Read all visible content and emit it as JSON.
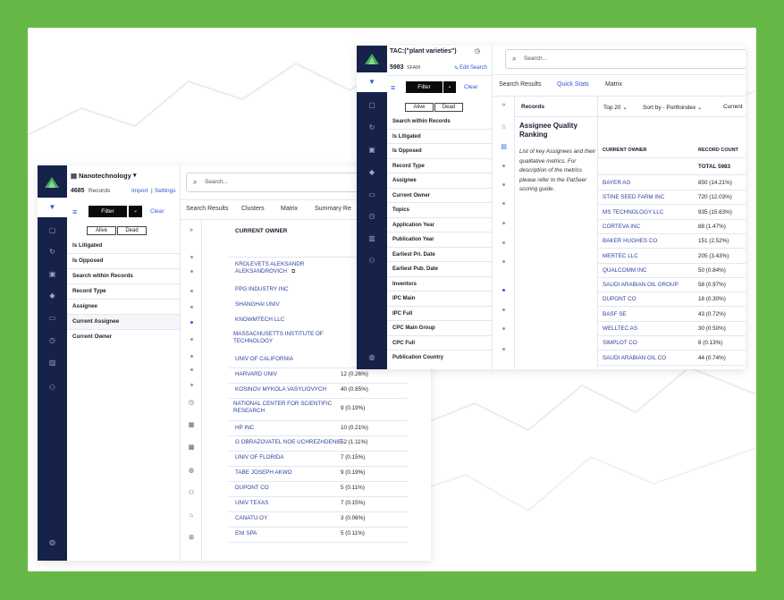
{
  "colors": {
    "frame_green": "#66b846",
    "nav_navy": "#16224a",
    "link_blue": "#2a5bd7"
  },
  "left_panel": {
    "workspace_title": "Nanotechnology",
    "records_count": "4685",
    "records_label": "Records",
    "import_label": "Import",
    "settings_label": "Settings",
    "filter_label": "Filter",
    "clear_label": "Clear",
    "alive_label": "Alive",
    "dead_label": "Dead",
    "menu": [
      "Is Litigated",
      "Is Opposed",
      "Search within Records",
      "Record Type",
      "Assignee",
      "Current Assignee",
      "Current Owner"
    ],
    "search_placeholder": "Search...",
    "tabs": [
      "Search Results",
      "Clusters",
      "Matrix",
      "Summary Re"
    ],
    "column_header": "CURRENT OWNER",
    "rows": [
      {
        "owner": "KROLEVETS ALEKSANDR ALEKSANDROVICH",
        "count": ""
      },
      {
        "owner": "PPG INDUSTRY INC",
        "count": ""
      },
      {
        "owner": "SHANGHAI UNIV",
        "count": ""
      },
      {
        "owner": "KNOWMTECH LLC",
        "count": ""
      },
      {
        "owner": "MASSACHUSETTS INSTITUTE OF TECHNOLOGY",
        "count": ""
      },
      {
        "owner": "UNIV OF CALIFORNIA",
        "count": ""
      },
      {
        "owner": "HARVARD UNIV",
        "count": "12 (0.26%)"
      },
      {
        "owner": "KOSINOV MYKOLA VASYLIOVYCH",
        "count": "40 (0.85%)"
      },
      {
        "owner": "NATIONAL CENTER FOR SCIENTIFIC RESEARCH",
        "count": "9 (0.19%)"
      },
      {
        "owner": "HP INC",
        "count": "10 (0.21%)"
      },
      {
        "owner": "G OBRAZOVATEL NOE UCHREZHDENIE",
        "count": "52 (1.11%)"
      },
      {
        "owner": "UNIV OF FLORIDA",
        "count": "7 (0.15%)"
      },
      {
        "owner": "TABE JOSEPH AKWO",
        "count": "9 (0.19%)"
      },
      {
        "owner": "DUPONT CO",
        "count": "5 (0.11%)"
      },
      {
        "owner": "UNIV TEXAS",
        "count": "7 (0.15%)"
      },
      {
        "owner": "CANATU OY",
        "count": "3 (0.06%)"
      },
      {
        "owner": "ENI SPA",
        "count": "5 (0.11%)"
      }
    ]
  },
  "right_panel": {
    "query_title": "TAC:(\"plant varieties\")",
    "records_count": "5983",
    "records_label": "SFAM",
    "edit_search_label": "Edit Search",
    "filter_label": "Filter",
    "clear_label": "Clear",
    "alive_label": "Alive",
    "dead_label": "Dead",
    "menu": [
      "Search within Records",
      "Is Litigated",
      "Is Opposed",
      "Record Type",
      "Assignee",
      "Current Owner",
      "Topics",
      "Application Year",
      "Publication Year",
      "Earliest Pri. Date",
      "Earliest Pub. Date",
      "Inventors",
      "IPC Main",
      "IPC Full",
      "CPC Main Group",
      "CPC Full",
      "Publication Country"
    ],
    "search_placeholder": "Search...",
    "tabs": [
      "Search Results",
      "Quick Stats",
      "Matrix"
    ],
    "records_header": "Records",
    "card_title": "Assignee Quality Ranking",
    "card_desc": "List of key Assignees and their qualitative metrics. For description of the metrics please refer to the PatSeer scoring guide.",
    "top_dropdown": "Top 20",
    "sort_dropdown": "Sort by - Portfoindex",
    "current_label": "Current",
    "col_owner": "CURRENT OWNER",
    "col_count": "RECORD COUNT",
    "total": "TOTAL 5983",
    "rows": [
      {
        "owner": "BAYER AG",
        "count": "850 (14.21%)"
      },
      {
        "owner": "STINE SEED FARM INC",
        "count": "720 (12.03%)"
      },
      {
        "owner": "MS TECHNOLOGY LLC",
        "count": "935 (15.63%)"
      },
      {
        "owner": "CORTEVA INC",
        "count": "88 (1.47%)"
      },
      {
        "owner": "BAKER HUGHES CO",
        "count": "151 (2.52%)"
      },
      {
        "owner": "MERTEC LLC",
        "count": "205 (3.43%)"
      },
      {
        "owner": "QUALCOMM INC",
        "count": "50 (0.84%)"
      },
      {
        "owner": "SAUDI ARABIAN OIL GROUP",
        "count": "58 (0.97%)"
      },
      {
        "owner": "DUPONT CO",
        "count": "18 (0.30%)"
      },
      {
        "owner": "BASF SE",
        "count": "43 (0.72%)"
      },
      {
        "owner": "WELLTEC AS",
        "count": "30 (0.50%)"
      },
      {
        "owner": "SIMPLOT CO",
        "count": "8 (0.13%)"
      },
      {
        "owner": "SAUDI ARABIAN OIL CO",
        "count": "44 (0.74%)"
      }
    ]
  }
}
